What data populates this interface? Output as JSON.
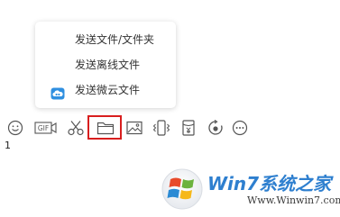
{
  "popup_menu": {
    "items": [
      {
        "label": "发送文件/文件夹",
        "icon": null
      },
      {
        "label": "发送离线文件",
        "icon": null
      },
      {
        "label": "发送微云文件",
        "icon": "weiyun-cloud-icon"
      }
    ]
  },
  "toolbar": {
    "buttons": [
      {
        "name": "emoji-button",
        "icon": "smiley-icon"
      },
      {
        "name": "gif-button",
        "icon": "gif-icon",
        "text": "GIF"
      },
      {
        "name": "screenshot-button",
        "icon": "scissors-icon"
      },
      {
        "name": "send-file-button",
        "icon": "folder-icon",
        "highlighted": true
      },
      {
        "name": "image-button",
        "icon": "image-icon"
      },
      {
        "name": "shake-button",
        "icon": "phone-vibrate-icon"
      },
      {
        "name": "red-packet-button",
        "icon": "yuan-packet-icon"
      },
      {
        "name": "voice-button",
        "icon": "circle-arrow-icon"
      },
      {
        "name": "more-button",
        "icon": "more-dots-icon"
      }
    ],
    "highlight_color": "#d81e1e"
  },
  "input_area": {
    "text": "1"
  },
  "watermark": {
    "title": "Win7系统之家",
    "url": "Www.Winwin7.com",
    "accent_color": "#2e7fcf"
  }
}
